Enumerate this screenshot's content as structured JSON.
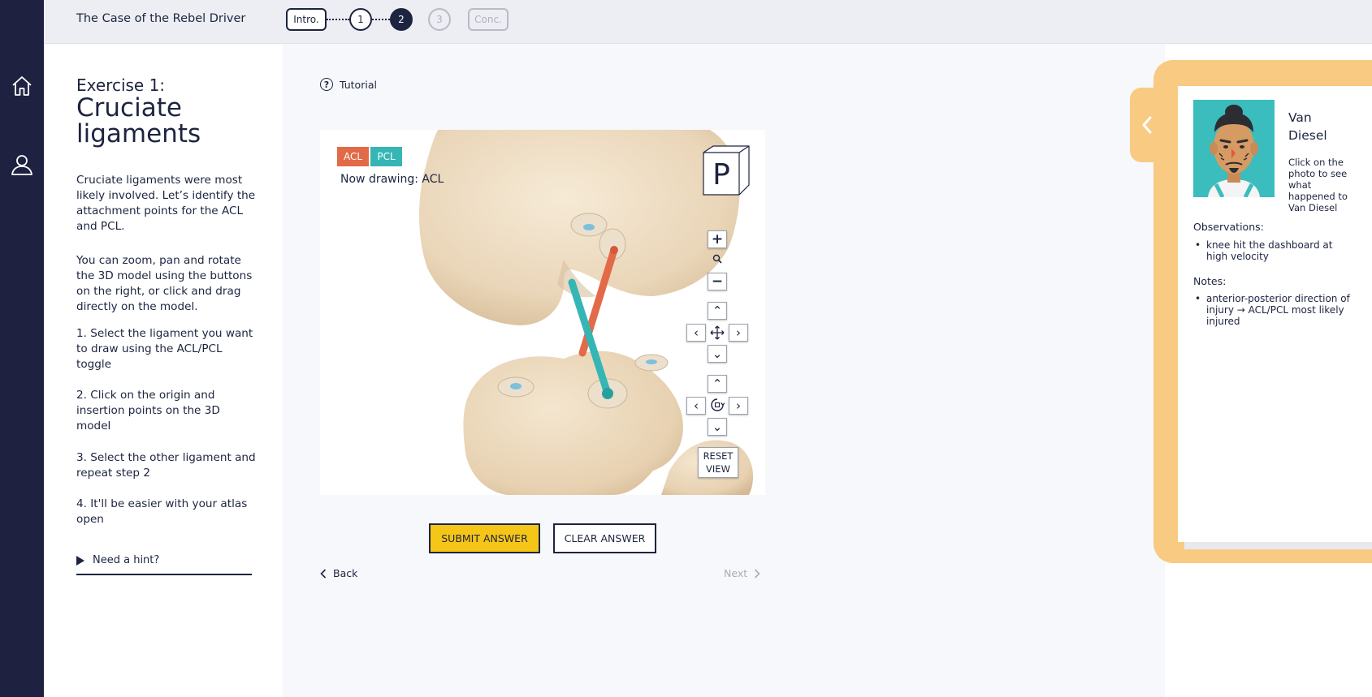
{
  "app": {
    "case_title": "The Case of the Rebel Driver"
  },
  "nav": {
    "home_icon": "home-icon",
    "profile_icon": "user-icon"
  },
  "progress": {
    "steps": [
      "Intro.",
      "1",
      "2",
      "3",
      "Conc."
    ],
    "current": "2"
  },
  "exercise": {
    "label": "Exercise 1:",
    "title": "Cruciate ligaments",
    "paragraphs": [
      "Cruciate ligaments were most likely involved. Let’s identify the attachment points for the ACL and PCL.",
      "You can zoom, pan and rotate the 3D model using the buttons on the right, or click and drag directly on the model.",
      "1. Select the ligament you want to draw using the ACL/PCL toggle",
      "2. Click on the origin and insertion points on the 3D model",
      "3. Select the other ligament and repeat step 2",
      "4. It'll be easier with your atlas open"
    ],
    "hint": "Need a hint?"
  },
  "main": {
    "tutorial": "Tutorial",
    "toggle": {
      "acl": "ACL",
      "pcl": "PCL"
    },
    "now_drawing": "Now drawing: ACL",
    "cube_face": "P",
    "reset_line1": "RESET",
    "reset_line2": "VIEW",
    "submit": "SUBMIT ANSWER",
    "clear": "CLEAR ANSWER",
    "back": "Back",
    "next": "Next"
  },
  "colors": {
    "acl": "#e36a48",
    "pcl": "#35b6b5",
    "submit": "#f5c518",
    "navy": "#1d2440",
    "folder": "#f9ca82"
  },
  "patient": {
    "name": "Van Diesel",
    "click_hint": "Click on the photo to see what happened to Van Diesel",
    "observations_heading": "Observations:",
    "observations": [
      "knee hit the dashboard at high velocity"
    ],
    "notes_heading": "Notes:",
    "notes": [
      "anterior-posterior direction of injury → ACL/PCL most likely injured"
    ]
  }
}
